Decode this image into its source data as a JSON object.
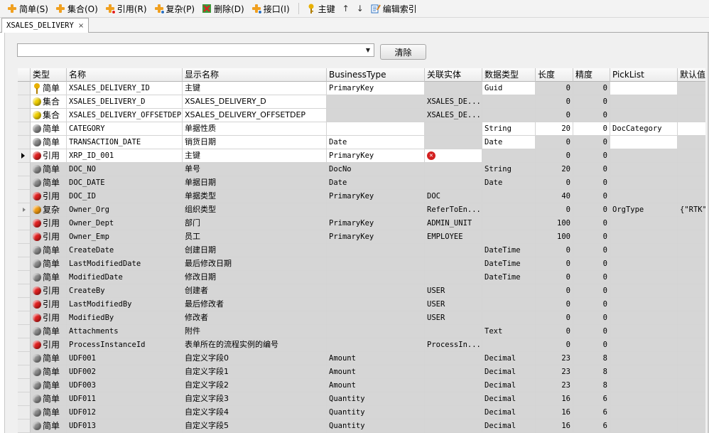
{
  "toolbar": {
    "items": [
      {
        "label": "简单(S)",
        "icon": "add-simple-icon",
        "color": "#f0a020"
      },
      {
        "label": "集合(O)",
        "icon": "add-collection-icon",
        "color": "#f0a020"
      },
      {
        "label": "引用(R)",
        "icon": "add-reference-icon",
        "color": "#f0a020"
      },
      {
        "label": "复杂(P)",
        "icon": "add-complex-icon",
        "color": "#f0a020"
      },
      {
        "label": "删除(D)",
        "icon": "delete-icon",
        "color": "#3a9a3a"
      },
      {
        "label": "接口(I)",
        "icon": "interface-icon",
        "color": "#f0a020"
      },
      {
        "label": "主键",
        "icon": "key-icon",
        "color": "#e8b000"
      },
      {
        "label": "↑",
        "icon": "move-up-icon"
      },
      {
        "label": "↓",
        "icon": "move-down-icon"
      },
      {
        "label": "编辑索引",
        "icon": "edit-index-icon",
        "color": "#2a6fc0"
      }
    ]
  },
  "tab": {
    "title": "XSALES_DELIVERY",
    "close": "×"
  },
  "filter": {
    "value": "",
    "dropdown_arrow": "▼",
    "clear_label": "清除"
  },
  "grid": {
    "columns": [
      "类型",
      "名称",
      "显示名称",
      "BusinessType",
      "关联实体",
      "数据类型",
      "长度",
      "精度",
      "PickList",
      "默认值"
    ],
    "rows": [
      {
        "kind": "key",
        "type": "简单",
        "name": "XSALES_DELIVERY_ID",
        "display": "主键",
        "btype": "PrimaryKey",
        "entity": "",
        "dtype": "Guid",
        "len": "0",
        "prec": "0",
        "pick": "",
        "def": ""
      },
      {
        "kind": "yellow",
        "type": "集合",
        "name": "XSALES_DELIVERY_D",
        "display": "XSALES_DELIVERY_D",
        "btype": "",
        "entity": "XSALES_DE...",
        "dtype": "",
        "len": "0",
        "prec": "0",
        "pick": "",
        "def": ""
      },
      {
        "kind": "yellow",
        "type": "集合",
        "name": "XSALES_DELIVERY_OFFSETDEP",
        "display": "XSALES_DELIVERY_OFFSETDEP",
        "btype": "",
        "entity": "XSALES_DE...",
        "dtype": "",
        "len": "0",
        "prec": "0",
        "pick": "",
        "def": ""
      },
      {
        "kind": "gray",
        "type": "简单",
        "name": "CATEGORY",
        "display": "单据性质",
        "btype": "",
        "entity": "",
        "dtype": "String",
        "len": "20",
        "prec": "0",
        "pick": "DocCategory",
        "def": ""
      },
      {
        "kind": "gray",
        "type": "简单",
        "name": "TRANSACTION_DATE",
        "display": "销货日期",
        "btype": "Date",
        "entity": "",
        "dtype": "Date",
        "len": "0",
        "prec": "0",
        "pick": "",
        "def": ""
      },
      {
        "kind": "red",
        "type": "引用",
        "name": "XRP_ID_001",
        "display": "主键",
        "btype": "PrimaryKey",
        "entity": "",
        "dtype": "",
        "len": "0",
        "prec": "0",
        "pick": "",
        "def": "",
        "error": true,
        "current": true
      },
      {
        "kind": "gray",
        "type": "简单",
        "name": "DOC_NO",
        "display": "单号",
        "btype": "DocNo",
        "entity": "",
        "dtype": "String",
        "len": "20",
        "prec": "0",
        "pick": "",
        "def": ""
      },
      {
        "kind": "gray",
        "type": "简单",
        "name": "DOC_DATE",
        "display": "单据日期",
        "btype": "Date",
        "entity": "",
        "dtype": "Date",
        "len": "0",
        "prec": "0",
        "pick": "",
        "def": ""
      },
      {
        "kind": "red",
        "type": "引用",
        "name": "DOC_ID",
        "display": "单据类型",
        "btype": "PrimaryKey",
        "entity": "DOC",
        "dtype": "",
        "len": "40",
        "prec": "0",
        "pick": "",
        "def": ""
      },
      {
        "kind": "orange",
        "type": "复杂",
        "name": "Owner_Org",
        "display": "组织类型",
        "btype": "",
        "entity": "ReferToEn...",
        "dtype": "",
        "len": "0",
        "prec": "0",
        "pick": "OrgType",
        "def": "{\"RTK\"",
        "expander": true
      },
      {
        "kind": "red",
        "type": "引用",
        "name": "Owner_Dept",
        "display": "部门",
        "btype": "PrimaryKey",
        "entity": "ADMIN_UNIT",
        "dtype": "",
        "len": "100",
        "prec": "0",
        "pick": "",
        "def": ""
      },
      {
        "kind": "red",
        "type": "引用",
        "name": "Owner_Emp",
        "display": "员工",
        "btype": "PrimaryKey",
        "entity": "EMPLOYEE",
        "dtype": "",
        "len": "100",
        "prec": "0",
        "pick": "",
        "def": ""
      },
      {
        "kind": "gray",
        "type": "简单",
        "name": "CreateDate",
        "display": "创建日期",
        "btype": "",
        "entity": "",
        "dtype": "DateTime",
        "len": "0",
        "prec": "0",
        "pick": "",
        "def": ""
      },
      {
        "kind": "gray",
        "type": "简单",
        "name": "LastModifiedDate",
        "display": "最后修改日期",
        "btype": "",
        "entity": "",
        "dtype": "DateTime",
        "len": "0",
        "prec": "0",
        "pick": "",
        "def": ""
      },
      {
        "kind": "gray",
        "type": "简单",
        "name": "ModifiedDate",
        "display": "修改日期",
        "btype": "",
        "entity": "",
        "dtype": "DateTime",
        "len": "0",
        "prec": "0",
        "pick": "",
        "def": ""
      },
      {
        "kind": "red",
        "type": "引用",
        "name": "CreateBy",
        "display": "创建者",
        "btype": "",
        "entity": "USER",
        "dtype": "",
        "len": "0",
        "prec": "0",
        "pick": "",
        "def": ""
      },
      {
        "kind": "red",
        "type": "引用",
        "name": "LastModifiedBy",
        "display": "最后修改者",
        "btype": "",
        "entity": "USER",
        "dtype": "",
        "len": "0",
        "prec": "0",
        "pick": "",
        "def": ""
      },
      {
        "kind": "red",
        "type": "引用",
        "name": "ModifiedBy",
        "display": "修改者",
        "btype": "",
        "entity": "USER",
        "dtype": "",
        "len": "0",
        "prec": "0",
        "pick": "",
        "def": ""
      },
      {
        "kind": "gray",
        "type": "简单",
        "name": "Attachments",
        "display": "附件",
        "btype": "",
        "entity": "",
        "dtype": "Text",
        "len": "0",
        "prec": "0",
        "pick": "",
        "def": ""
      },
      {
        "kind": "red",
        "type": "引用",
        "name": "ProcessInstanceId",
        "display": "表单所在的流程实例的编号",
        "btype": "",
        "entity": "ProcessIn...",
        "dtype": "",
        "len": "0",
        "prec": "0",
        "pick": "",
        "def": ""
      },
      {
        "kind": "gray",
        "type": "简单",
        "name": "UDF001",
        "display": "自定义字段0",
        "btype": "Amount",
        "entity": "",
        "dtype": "Decimal",
        "len": "23",
        "prec": "8",
        "pick": "",
        "def": ""
      },
      {
        "kind": "gray",
        "type": "简单",
        "name": "UDF002",
        "display": "自定义字段1",
        "btype": "Amount",
        "entity": "",
        "dtype": "Decimal",
        "len": "23",
        "prec": "8",
        "pick": "",
        "def": ""
      },
      {
        "kind": "gray",
        "type": "简单",
        "name": "UDF003",
        "display": "自定义字段2",
        "btype": "Amount",
        "entity": "",
        "dtype": "Decimal",
        "len": "23",
        "prec": "8",
        "pick": "",
        "def": ""
      },
      {
        "kind": "gray",
        "type": "简单",
        "name": "UDF011",
        "display": "自定义字段3",
        "btype": "Quantity",
        "entity": "",
        "dtype": "Decimal",
        "len": "16",
        "prec": "6",
        "pick": "",
        "def": ""
      },
      {
        "kind": "gray",
        "type": "简单",
        "name": "UDF012",
        "display": "自定义字段4",
        "btype": "Quantity",
        "entity": "",
        "dtype": "Decimal",
        "len": "16",
        "prec": "6",
        "pick": "",
        "def": ""
      },
      {
        "kind": "gray",
        "type": "简单",
        "name": "UDF013",
        "display": "自定义字段5",
        "btype": "Quantity",
        "entity": "",
        "dtype": "Decimal",
        "len": "16",
        "prec": "6",
        "pick": "",
        "def": ""
      }
    ]
  },
  "colors": {
    "red": "#e02020",
    "yellow": "#f0d000",
    "gray": "#8a8a8a",
    "orange": "#f09a10",
    "key": "#e8b000"
  }
}
